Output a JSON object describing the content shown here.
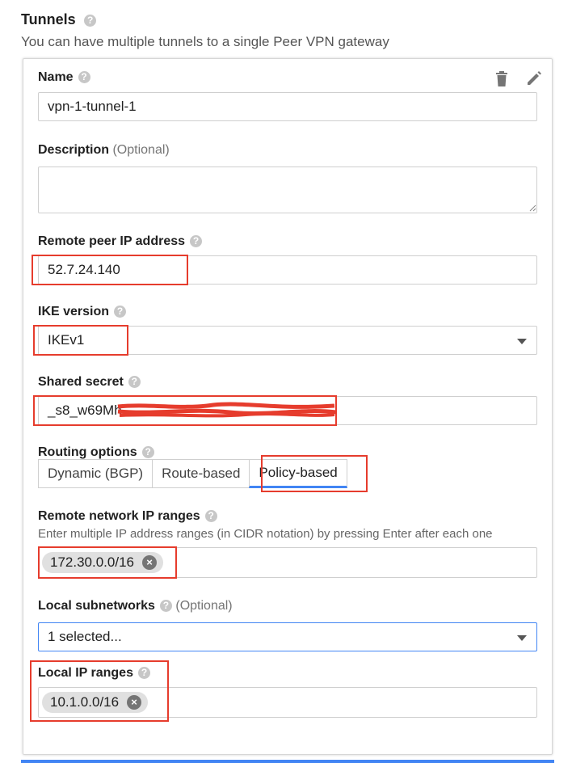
{
  "section": {
    "title": "Tunnels",
    "description": "You can have multiple tunnels to a single Peer VPN gateway"
  },
  "tunnel": {
    "name_label": "Name",
    "name_value": "vpn-1-tunnel-1",
    "description_label": "Description",
    "description_optional": "(Optional)",
    "description_value": "",
    "remote_peer_label": "Remote peer IP address",
    "remote_peer_value": "52.7.24.140",
    "ike_label": "IKE version",
    "ike_value": "IKEv1",
    "secret_label": "Shared secret",
    "secret_value": "_s8_w69Mh",
    "routing_label": "Routing options",
    "routing_options": [
      "Dynamic (BGP)",
      "Route-based",
      "Policy-based"
    ],
    "routing_selected": "Policy-based",
    "remote_ranges_label": "Remote network IP ranges",
    "remote_ranges_hint": "Enter multiple IP address ranges (in CIDR notation) by pressing Enter after each one",
    "remote_ranges_chip": "172.30.0.0/16",
    "local_subnets_label": "Local subnetworks",
    "local_subnets_optional": "(Optional)",
    "local_subnets_value": "1 selected...",
    "local_ranges_label": "Local IP ranges",
    "local_ranges_chip": "10.1.0.0/16"
  },
  "icons": {
    "help": "?",
    "chip_remove": "×",
    "delete": "trash-icon",
    "edit": "pencil-icon"
  },
  "colors": {
    "accent": "#4285f4",
    "annotation": "#e63c2d"
  }
}
